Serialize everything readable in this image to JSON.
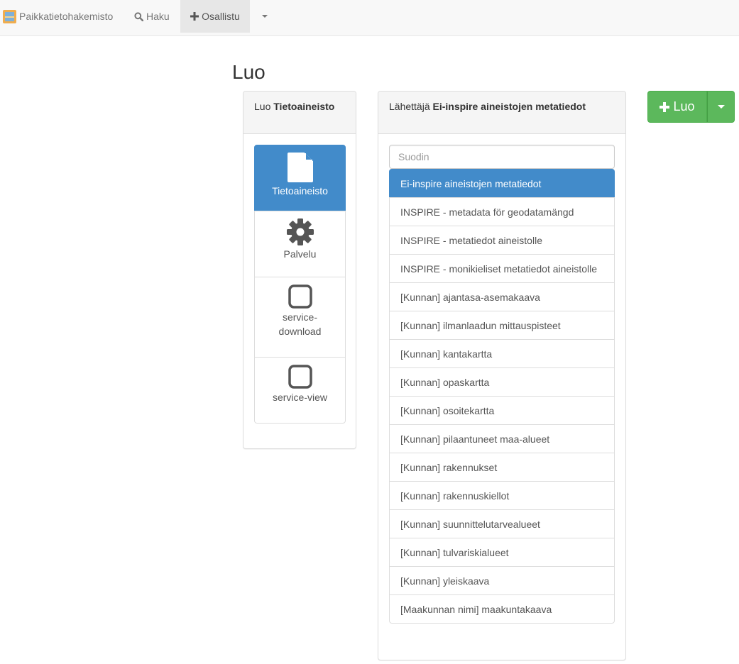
{
  "navbar": {
    "brand": "Paikkatietohakemisto",
    "search_label": "Haku",
    "contribute_label": "Osallistu"
  },
  "page": {
    "title": "Luo"
  },
  "type_panel": {
    "heading_prefix": "Luo",
    "heading_value": "Tietoaineisto",
    "items": [
      {
        "label": "Tietoaineisto",
        "icon": "file-icon"
      },
      {
        "label": "Palvelu",
        "icon": "gear-icon"
      },
      {
        "label": "service-download",
        "icon": "square-icon"
      },
      {
        "label": "service-view",
        "icon": "square-icon"
      }
    ]
  },
  "template_panel": {
    "heading_prefix": "Lähettäjä",
    "heading_value": "Ei-inspire aineistojen metatiedot",
    "filter_placeholder": "Suodin",
    "items": [
      "Ei-inspire aineistojen metatiedot",
      "INSPIRE - metadata för geodatamängd",
      "INSPIRE - metatiedot aineistolle",
      "INSPIRE - monikieliset metatiedot aineistolle",
      "[Kunnan] ajantasa-asemakaava",
      "[Kunnan] ilmanlaadun mittauspisteet",
      "[Kunnan] kantakartta",
      "[Kunnan] opaskartta",
      "[Kunnan] osoitekartta",
      "[Kunnan] pilaantuneet maa-alueet",
      "[Kunnan] rakennukset",
      "[Kunnan] rakennuskiellot",
      "[Kunnan] suunnittelutarvealueet",
      "[Kunnan] tulvariskialueet",
      "[Kunnan] yleiskaava",
      "[Maakunnan nimi] maakuntakaava"
    ]
  },
  "create_button": {
    "label": "Luo"
  },
  "colors": {
    "active": "#428bca",
    "success": "#5cb85c"
  }
}
